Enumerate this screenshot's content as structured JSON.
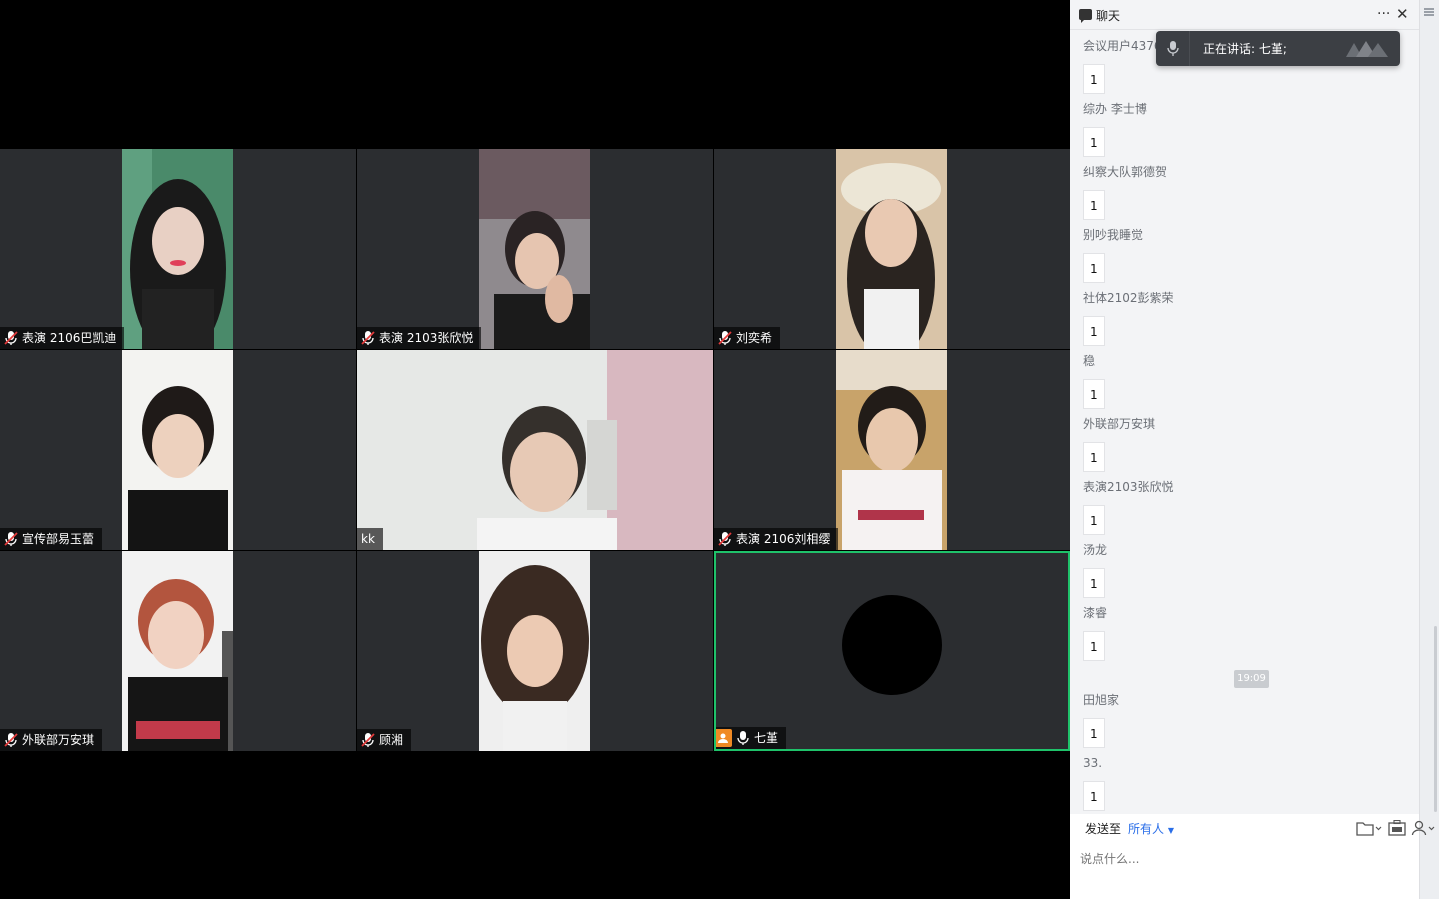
{
  "participants": [
    {
      "name": "表演 2106巴凯迪",
      "muted": true
    },
    {
      "name": "表演 2103张欣悦",
      "muted": true
    },
    {
      "name": "刘奕希",
      "muted": true
    },
    {
      "name": "宣传部易玉蕾",
      "muted": true
    },
    {
      "name": "kk",
      "muted": false
    },
    {
      "name": "表演 2106刘相缨",
      "muted": true
    },
    {
      "name": "外联部万安琪",
      "muted": true
    },
    {
      "name": "顾湘",
      "muted": true
    },
    {
      "name": "七堇",
      "muted": false,
      "host": true,
      "speaking": true
    }
  ],
  "chat": {
    "title": "聊天",
    "more_label": "···",
    "close_label": "✕",
    "speaking_toast": "正在讲话: 七堇;",
    "messages": [
      {
        "sender": "会议用户4376",
        "text": "1"
      },
      {
        "sender": "综办 李士博",
        "text": "1"
      },
      {
        "sender": "纠察大队郭德贺",
        "text": "1"
      },
      {
        "sender": "别吵我睡觉",
        "text": "1"
      },
      {
        "sender": "社体2102彭紫荣",
        "text": "1"
      },
      {
        "sender": "稳",
        "text": "1"
      },
      {
        "sender": "外联部万安琪",
        "text": "1"
      },
      {
        "sender": "表演2103张欣悦",
        "text": "1"
      },
      {
        "sender": "汤龙",
        "text": "1"
      },
      {
        "sender": "漆睿",
        "text": "1"
      },
      {
        "sender": "田旭家",
        "text": "1"
      },
      {
        "sender": "33.",
        "text": "1"
      }
    ],
    "time_divider": "19:09",
    "send_to_label": "发送至",
    "recipient": "所有人",
    "input_placeholder": "说点什么..."
  },
  "colors": {
    "tile_bg": "#2b2d30",
    "active_border": "#1fc26a",
    "link_blue": "#2a6ee8",
    "mute_red": "#e23b3b"
  }
}
